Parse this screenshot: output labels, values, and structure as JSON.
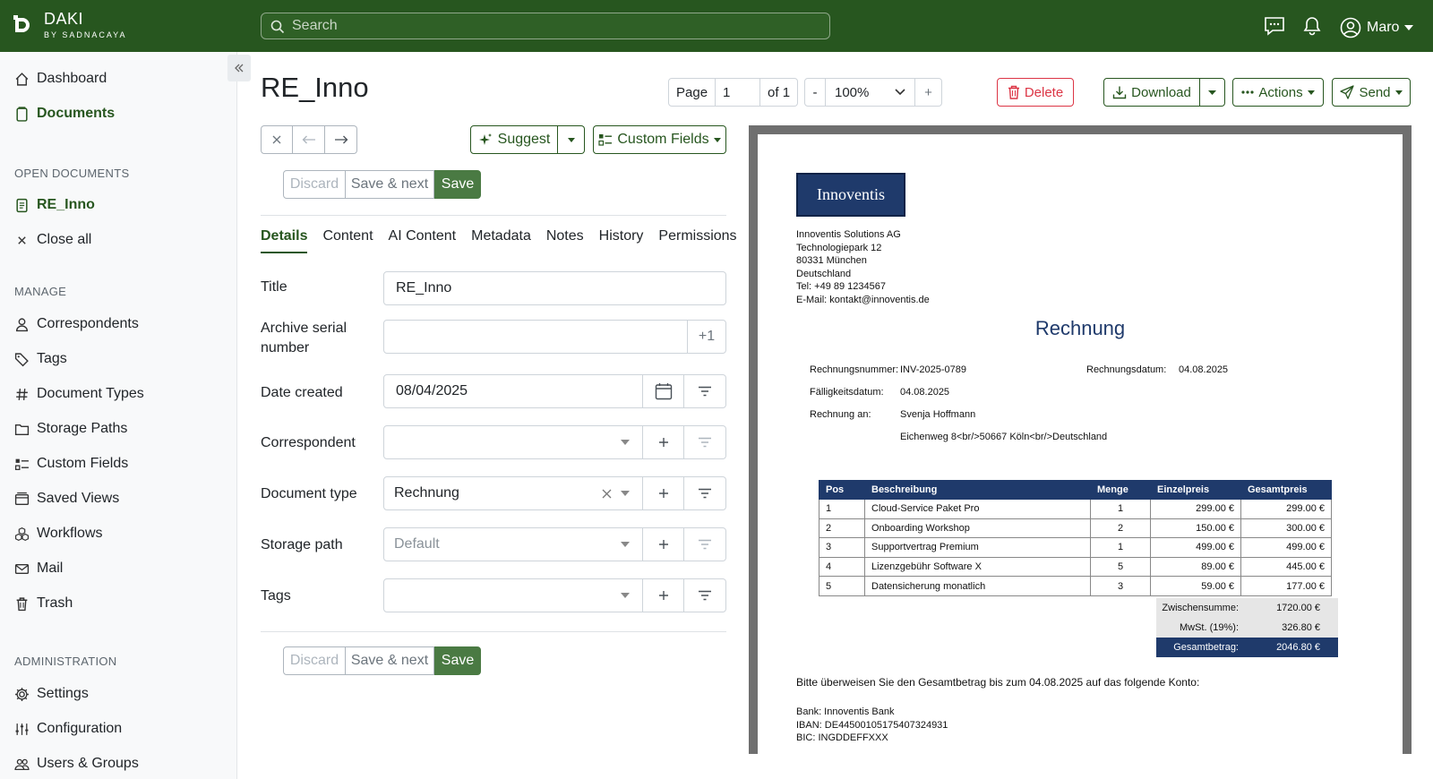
{
  "app": {
    "brand_name": "DAKI",
    "brand_sub": "BY SADNACAYA",
    "search_placeholder": "Search",
    "user_name": "Maro"
  },
  "sidebar": {
    "items_top": [
      {
        "label": "Dashboard"
      },
      {
        "label": "Documents"
      }
    ],
    "open_documents_heading": "OPEN DOCUMENTS",
    "open_doc": "RE_Inno",
    "close_all": "Close all",
    "manage_heading": "MANAGE",
    "manage": [
      {
        "label": "Correspondents"
      },
      {
        "label": "Tags"
      },
      {
        "label": "Document Types"
      },
      {
        "label": "Storage Paths"
      },
      {
        "label": "Custom Fields"
      },
      {
        "label": "Saved Views"
      },
      {
        "label": "Workflows"
      },
      {
        "label": "Mail"
      },
      {
        "label": "Trash"
      }
    ],
    "admin_heading": "ADMINISTRATION",
    "admin": [
      {
        "label": "Settings"
      },
      {
        "label": "Configuration"
      },
      {
        "label": "Users & Groups"
      }
    ]
  },
  "document": {
    "title": "RE_Inno",
    "page_label": "Page",
    "page_value": "1",
    "page_of": "of 1",
    "zoom_minus": "-",
    "zoom_value": "100%",
    "zoom_plus": "+",
    "delete": "Delete",
    "download": "Download",
    "actions": "Actions",
    "send": "Send",
    "suggest": "Suggest",
    "custom_fields": "Custom Fields",
    "discard": "Discard",
    "save_next": "Save & next",
    "save": "Save",
    "tabs": [
      "Details",
      "Content",
      "AI Content",
      "Metadata",
      "Notes",
      "History",
      "Permissions"
    ]
  },
  "form": {
    "title_label": "Title",
    "title_value": "RE_Inno",
    "asn_label_1": "Archive serial",
    "asn_label_2": "number",
    "asn_value": "",
    "asn_plus": "+1",
    "date_label": "Date created",
    "date_value": "08/04/2025",
    "correspondent_label": "Correspondent",
    "correspondent_value": "",
    "doctype_label": "Document type",
    "doctype_value": "Rechnung",
    "storage_label": "Storage path",
    "storage_placeholder": "Default",
    "tags_label": "Tags",
    "tags_value": ""
  },
  "invoice": {
    "logo": "Innoventis",
    "address": [
      "Innoventis Solutions AG",
      "Technologiepark 12",
      "80331 München",
      "Deutschland",
      "Tel: +49 89 1234567",
      "E-Mail: kontakt@innoventis.de"
    ],
    "heading": "Rechnung",
    "nr_label": "Rechnungsnummer:",
    "nr_value": "INV-2025-0789",
    "date_label": "Rechnungsdatum:",
    "date_value": "04.08.2025",
    "due_label": "Fälligkeitsdatum:",
    "due_value": "04.08.2025",
    "to_label": "Rechnung an:",
    "to_name": "Svenja Hoffmann",
    "to_address": "Eichenweg 8<br/>50667 Köln<br/>Deutschland",
    "columns": [
      "Pos",
      "Beschreibung",
      "Menge",
      "Einzelpreis",
      "Gesamtpreis"
    ],
    "rows": [
      [
        "1",
        "Cloud-Service Paket Pro",
        "1",
        "299.00 €",
        "299.00 €"
      ],
      [
        "2",
        "Onboarding Workshop",
        "2",
        "150.00 €",
        "300.00 €"
      ],
      [
        "3",
        "Supportvertrag Premium",
        "1",
        "499.00 €",
        "499.00 €"
      ],
      [
        "4",
        "Lizenzgebühr Software X",
        "5",
        "89.00 €",
        "445.00 €"
      ],
      [
        "5",
        "Datensicherung monatlich",
        "3",
        "59.00 €",
        "177.00 €"
      ]
    ],
    "subtotal_label": "Zwischensumme:",
    "subtotal_value": "1720.00 €",
    "vat_label": "MwSt. (19%):",
    "vat_value": "326.80 €",
    "total_label": "Gesamtbetrag:",
    "total_value": "2046.80 €",
    "note": "Bitte überweisen Sie den Gesamtbetrag bis zum 04.08.2025 auf das folgende Konto:",
    "bank": [
      "Bank: Innoventis Bank",
      "IBAN: DE44500105175407324931",
      "BIC: INGDDEFFXXX"
    ]
  },
  "colors": {
    "brand_green": "#27561f",
    "save_green": "#4a7a43",
    "danger": "#dc3545",
    "invoice_navy": "#1f3a6b"
  }
}
